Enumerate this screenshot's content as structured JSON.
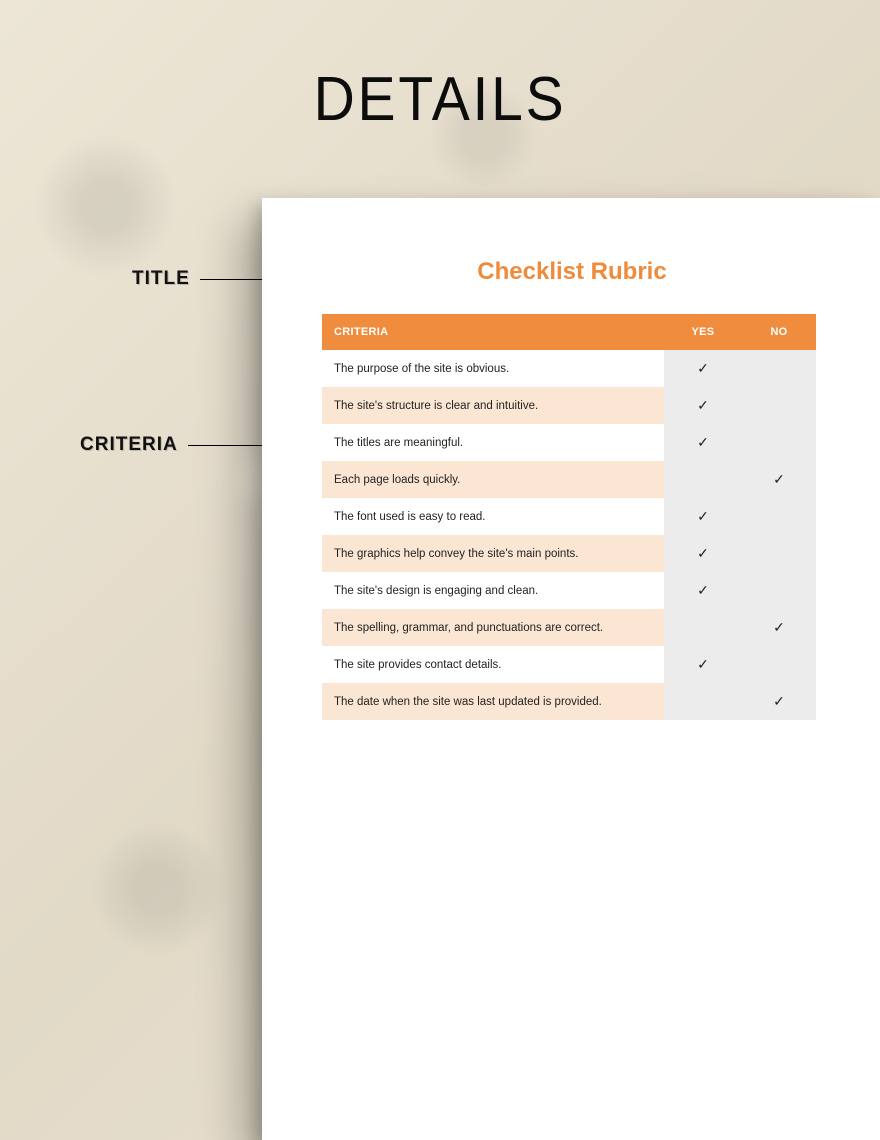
{
  "heading": "DETAILS",
  "callouts": {
    "title": "TITLE",
    "criteria": "CRITERIA"
  },
  "document": {
    "title": "Checklist Rubric",
    "columns": {
      "criteria": "CRITERIA",
      "yes": "YES",
      "no": "NO"
    },
    "checkmark": "✓",
    "rows": [
      {
        "text": "The purpose of the site is obvious.",
        "yes": true,
        "no": false
      },
      {
        "text": "The site's structure is clear and intuitive.",
        "yes": true,
        "no": false
      },
      {
        "text": "The titles are meaningful.",
        "yes": true,
        "no": false
      },
      {
        "text": "Each page loads quickly.",
        "yes": false,
        "no": true
      },
      {
        "text": "The font used is easy to read.",
        "yes": true,
        "no": false
      },
      {
        "text": "The graphics help convey the site's main points.",
        "yes": true,
        "no": false
      },
      {
        "text": "The site's design is engaging and clean.",
        "yes": true,
        "no": false
      },
      {
        "text": "The spelling, grammar, and punctuations are correct.",
        "yes": false,
        "no": true
      },
      {
        "text": "The site provides contact details.",
        "yes": true,
        "no": false
      },
      {
        "text": "The date when the site was last updated is provided.",
        "yes": false,
        "no": true
      }
    ]
  },
  "colors": {
    "accent": "#ef8b3a",
    "row_alt": "#fbe6d4",
    "mark_bg": "#ececec"
  }
}
